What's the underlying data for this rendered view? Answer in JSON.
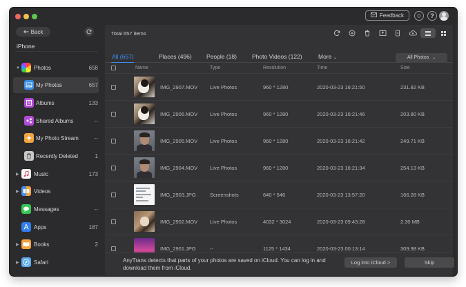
{
  "window": {
    "feedback_label": "Feedback",
    "help_label": "?"
  },
  "sidebar": {
    "back_label": "Back",
    "device_name": "iPhone",
    "items": [
      {
        "label": "Photos",
        "count": "658",
        "icon": "photos-icon",
        "expanded": true
      },
      {
        "label": "My Photos",
        "count": "657",
        "icon": "my-photos-icon",
        "selected": true
      },
      {
        "label": "Albums",
        "count": "133",
        "icon": "albums-icon"
      },
      {
        "label": "Shared Albums",
        "count": "--",
        "icon": "shared-albums-icon"
      },
      {
        "label": "My Photo Stream",
        "count": "--",
        "icon": "photo-stream-icon"
      },
      {
        "label": "Recently Deleted",
        "count": "1",
        "icon": "trash-icon"
      },
      {
        "label": "Music",
        "count": "173",
        "icon": "music-icon"
      },
      {
        "label": "Videos",
        "count": "",
        "icon": "videos-icon"
      },
      {
        "label": "Messages",
        "count": "--",
        "icon": "messages-icon"
      },
      {
        "label": "Apps",
        "count": "187",
        "icon": "apps-icon"
      },
      {
        "label": "Books",
        "count": "2",
        "icon": "books-icon"
      },
      {
        "label": "Safari",
        "count": "",
        "icon": "safari-icon"
      }
    ]
  },
  "main": {
    "total_text": "Total 657 items",
    "tabs": [
      {
        "label": "All (657)",
        "active": true
      },
      {
        "label": "Places (496)"
      },
      {
        "label": "People (18)"
      },
      {
        "label": "Photo Videos (122)"
      },
      {
        "label": "More"
      }
    ],
    "filter_label": "All Photos",
    "columns": [
      "Name",
      "Type",
      "Resolution",
      "Time",
      "Size"
    ],
    "rows": [
      {
        "name": "IMG_2907.MOV",
        "type": "Live Photos",
        "resolution": "960 * 1280",
        "time": "2020-03-23 16:21:50",
        "size": "231.82 KB",
        "thumb": "cat"
      },
      {
        "name": "IMG_2906.MOV",
        "type": "Live Photos",
        "resolution": "960 * 1280",
        "time": "2020-03-23 16:21:46",
        "size": "203.80 KB",
        "thumb": "cat"
      },
      {
        "name": "IMG_2905.MOV",
        "type": "Live Photos",
        "resolution": "960 * 1280",
        "time": "2020-03-23 16:21:42",
        "size": "249.71 KB",
        "thumb": "face"
      },
      {
        "name": "IMG_2904.MOV",
        "type": "Live Photos",
        "resolution": "960 * 1280",
        "time": "2020-03-23 16:21:34",
        "size": "254.13 KB",
        "thumb": "face"
      },
      {
        "name": "IMG_2903.JPG",
        "type": "Screenshots",
        "resolution": "640 * 546",
        "time": "2020-03-23 13:57:20",
        "size": "166.28 KB",
        "thumb": "shot"
      },
      {
        "name": "IMG_2902.MOV",
        "type": "Live Photos",
        "resolution": "4032 * 3024",
        "time": "2020-03-23 09:43:28",
        "size": "2.30 MB",
        "thumb": "cat2"
      },
      {
        "name": "IMG_2901.JPG",
        "type": "--",
        "resolution": "1125 * 1434",
        "time": "2020-03-23 00:13:14",
        "size": "309.98 KB",
        "thumb": "purple"
      }
    ]
  },
  "notice": {
    "message": "AnyTrans detects that parts of your photos are saved on iCloud. You can log in and download them from iCloud.",
    "login_label": "Log into iCloud >",
    "skip_label": "Skip"
  },
  "colors": {
    "accent": "#3d8ef0",
    "window_bg": "#2b2b2d",
    "panel_bg": "#333335"
  }
}
